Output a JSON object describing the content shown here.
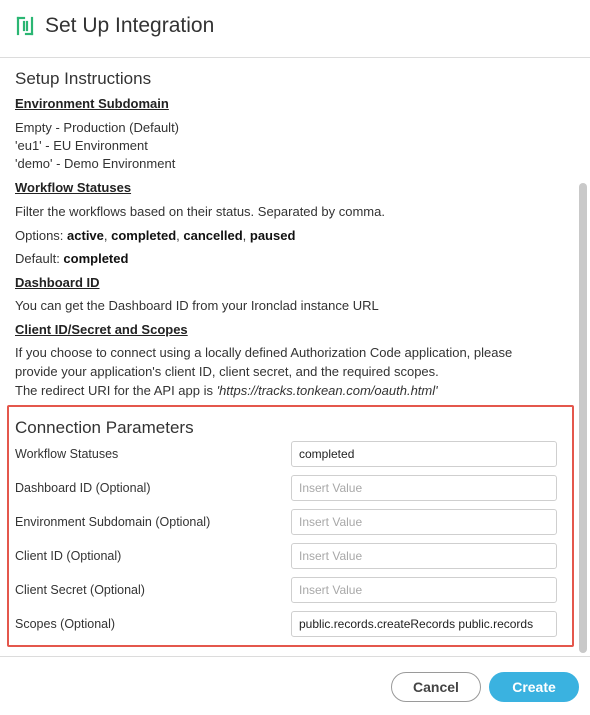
{
  "header": {
    "title": "Set Up Integration"
  },
  "instructions": {
    "title": "Setup Instructions",
    "env_heading": "Environment Subdomain",
    "env_lines": [
      "Empty - Production (Default)",
      "'eu1' - EU Environment",
      "'demo' - Demo Environment"
    ],
    "wf_heading": "Workflow Statuses",
    "wf_desc": "Filter the workflows based on their status. Separated by comma.",
    "wf_options_prefix": "Options: ",
    "wf_options": [
      "active",
      "completed",
      "cancelled",
      "paused"
    ],
    "wf_default_prefix": "Default: ",
    "wf_default": "completed",
    "dash_heading": "Dashboard ID",
    "dash_desc": "You can get the Dashboard ID from your Ironclad instance URL",
    "client_heading": "Client ID/Secret and Scopes",
    "client_lines": [
      "If you choose to connect using a locally defined Authorization Code application, please",
      "provide your application's client ID, client secret, and the required scopes."
    ],
    "redirect_prefix": "The redirect URI for the API app is ",
    "redirect_uri": "'https://tracks.tonkean.com/oauth.html'"
  },
  "connection": {
    "title": "Connection Parameters",
    "fields": [
      {
        "label": "Workflow Statuses",
        "value": "completed",
        "placeholder": "Insert Value"
      },
      {
        "label": "Dashboard ID (Optional)",
        "value": "",
        "placeholder": "Insert Value"
      },
      {
        "label": "Environment Subdomain (Optional)",
        "value": "",
        "placeholder": "Insert Value"
      },
      {
        "label": "Client ID (Optional)",
        "value": "",
        "placeholder": "Insert Value"
      },
      {
        "label": "Client Secret (Optional)",
        "value": "",
        "placeholder": "Insert Value"
      },
      {
        "label": "Scopes (Optional)",
        "value": "public.records.createRecords public.records",
        "placeholder": "Insert Value"
      }
    ]
  },
  "footer": {
    "cancel_label": "Cancel",
    "create_label": "Create"
  },
  "colors": {
    "accent": "#3ab2e0",
    "logo": "#2bb673",
    "highlight_border": "#e4574c"
  }
}
